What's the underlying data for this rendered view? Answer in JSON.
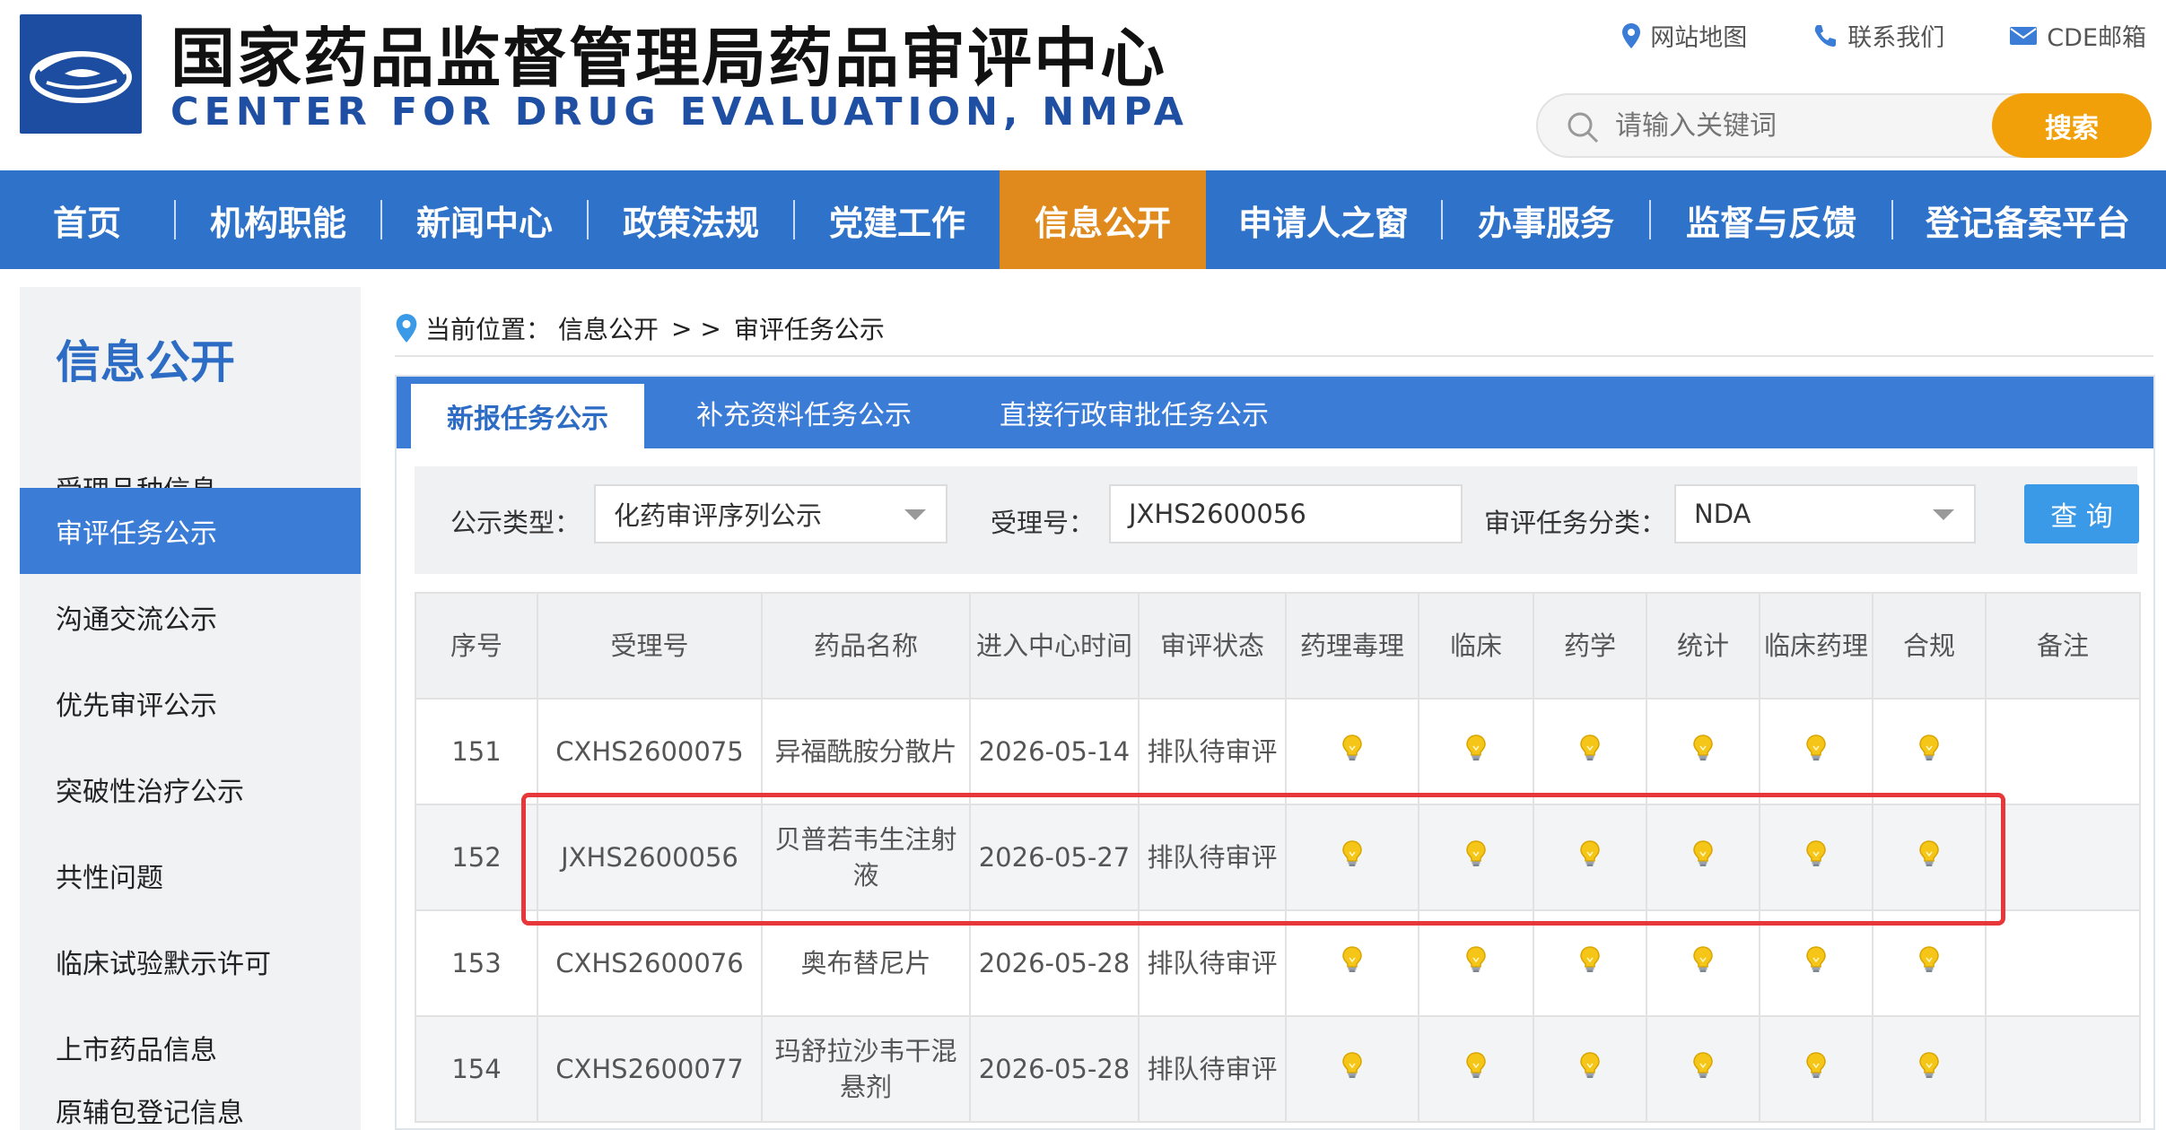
{
  "header": {
    "title_cn": "国家药品监督管理局药品审评中心",
    "title_en": "CENTER FOR DRUG EVALUATION, NMPA",
    "links": [
      {
        "label": "网站地图",
        "icon": "location-pin-icon"
      },
      {
        "label": "联系我们",
        "icon": "phone-icon"
      },
      {
        "label": "CDE邮箱",
        "icon": "mail-icon"
      }
    ],
    "search": {
      "placeholder": "请输入关键词",
      "button": "搜索"
    }
  },
  "nav": {
    "items": [
      "首页",
      "机构职能",
      "新闻中心",
      "政策法规",
      "党建工作",
      "信息公开",
      "申请人之窗",
      "办事服务",
      "监督与反馈",
      "登记备案平台"
    ],
    "active": "信息公开"
  },
  "sidebar": {
    "title": "信息公开",
    "items": [
      "受理品种信息",
      "审评任务公示",
      "沟通交流公示",
      "优先审评公示",
      "突破性治疗公示",
      "共性问题",
      "临床试验默示许可",
      "上市药品信息",
      "原辅包登记信息"
    ],
    "active": "审评任务公示"
  },
  "breadcrumb": {
    "prefix": "当前位置：",
    "section": "信息公开",
    "sep": "> >",
    "current": "审评任务公示"
  },
  "tabs": [
    "新报任务公示",
    "补充资料任务公示",
    "直接行政审批任务公示"
  ],
  "filter": {
    "type_label": "公示类型：",
    "type_value": "化药审评序列公示",
    "acceptance_label": "受理号：",
    "acceptance_value": "JXHS2600056",
    "category_label": "审评任务分类：",
    "category_value": "NDA",
    "query_button": "查 询"
  },
  "table": {
    "headers": [
      "序号",
      "受理号",
      "药品名称",
      "进入中心时间",
      "审评状态",
      "药理毒理",
      "临床",
      "药学",
      "统计",
      "临床药理",
      "合规",
      "备注"
    ],
    "rows": [
      {
        "no": "151",
        "id": "CXHS2600075",
        "name": "异福酰胺分散片",
        "date": "2026-05-14",
        "status": "排队待审评",
        "remark": ""
      },
      {
        "no": "152",
        "id": "JXHS2600056",
        "name": "贝普若韦生注射液",
        "date": "2026-05-27",
        "status": "排队待审评",
        "remark": ""
      },
      {
        "no": "153",
        "id": "CXHS2600076",
        "name": "奥布替尼片",
        "date": "2026-05-28",
        "status": "排队待审评",
        "remark": ""
      },
      {
        "no": "154",
        "id": "CXHS2600077",
        "name": "玛舒拉沙韦干混悬剂",
        "date": "2026-05-28",
        "status": "排队待审评",
        "remark": ""
      }
    ],
    "highlighted_row": "152",
    "status_icon": "lightbulb-icon"
  },
  "colors": {
    "nav_bg": "#2f72c9",
    "nav_active": "#e08a1e",
    "search_button": "#f2a00a",
    "highlight": "#e8373b",
    "link_red": "#c41a1a"
  }
}
